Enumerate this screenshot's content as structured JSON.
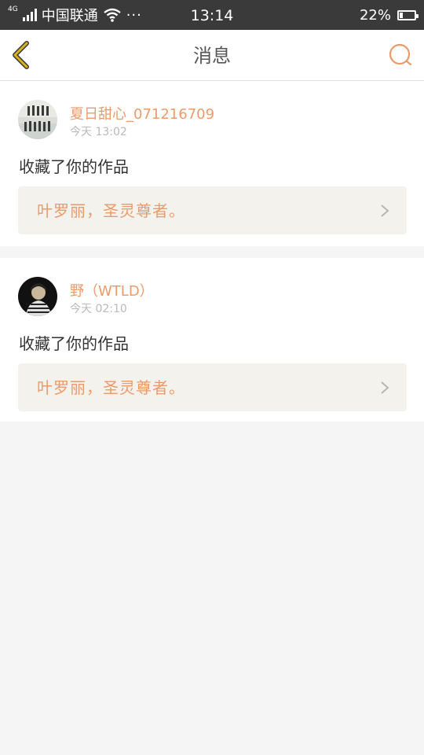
{
  "status_bar": {
    "network": "4G",
    "carrier": "中国联通",
    "more": "···",
    "time": "13:14",
    "battery_percent_text": "22%",
    "battery_level": 0.22
  },
  "header": {
    "title": "消息"
  },
  "messages": [
    {
      "user": "夏日甜心_071216709",
      "time": "今天 13:02",
      "action": "收藏了你的作品",
      "work_title": "叶罗丽，圣灵尊者。"
    },
    {
      "user": "野（WTLD）",
      "time": "今天 02:10",
      "action": "收藏了你的作品",
      "work_title": "叶罗丽，圣灵尊者。"
    }
  ],
  "colors": {
    "accent": "#ec9a6a",
    "back_icon": "#c9a514",
    "status_bar_bg": "#3a3a3a",
    "card_ref_bg": "#f3f2ec"
  },
  "icons": {
    "back": "chevron-left-icon",
    "search": "search-icon",
    "ref_arrow": "chevron-right-icon"
  }
}
